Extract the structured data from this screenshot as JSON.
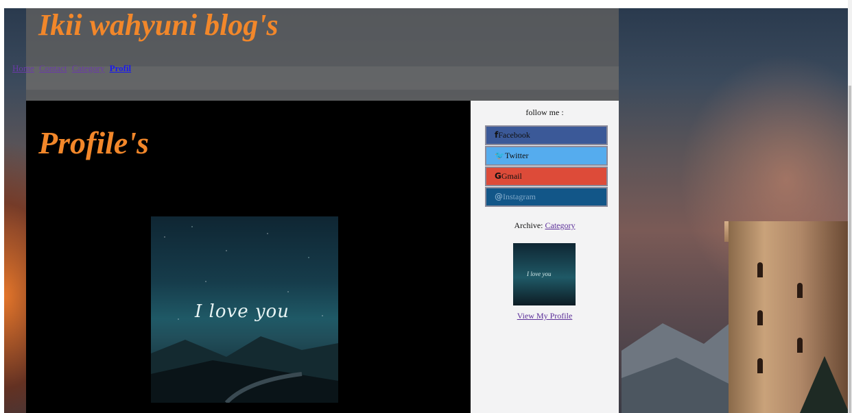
{
  "header": {
    "site_title": "Ikii wahyuni blog's"
  },
  "nav": {
    "items": [
      {
        "label": "Home"
      },
      {
        "label": "Contact"
      },
      {
        "label": "Category"
      },
      {
        "label": "Profil"
      }
    ]
  },
  "main": {
    "heading": "Profile's",
    "photo_text": "I love you"
  },
  "sidebar": {
    "follow_label": "follow me :",
    "social": [
      {
        "icon": "facebook-icon",
        "glyph": "f",
        "label": "Facebook",
        "color": "#3b5998"
      },
      {
        "icon": "twitter-icon",
        "glyph": "🐦",
        "label": "Twitter",
        "color": "#55acee"
      },
      {
        "icon": "gmail-icon",
        "glyph": "G",
        "label": "Gmail",
        "color": "#dd4b39"
      },
      {
        "icon": "instagram-icon",
        "glyph": "@",
        "label": "Instagram",
        "color": "#125688"
      }
    ],
    "archive_prefix": "Archive:",
    "archive_link": "Category",
    "thumb_text": "I love you",
    "view_profile": "View My Profile"
  },
  "colors": {
    "title_orange": "#f2872a",
    "link_purple": "#5a2d98",
    "active_link": "#1a1aee"
  }
}
